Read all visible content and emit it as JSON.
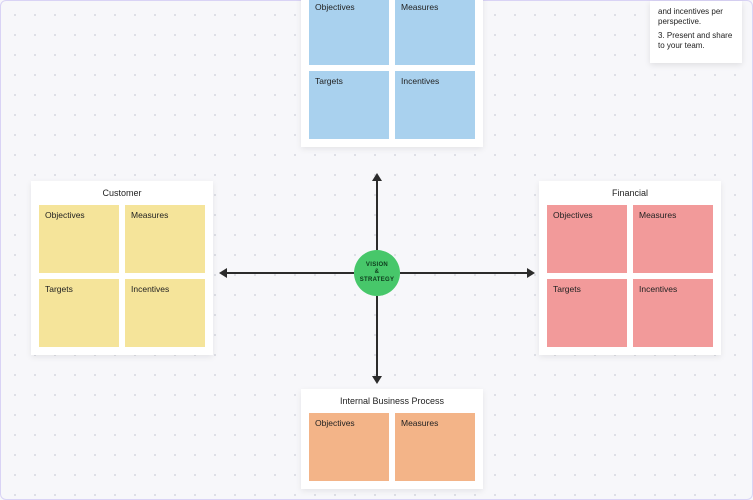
{
  "center": {
    "line1": "VISION",
    "line2": "&",
    "line3": "STRATEGY"
  },
  "quadrants": {
    "top": {
      "title": "",
      "cells": [
        "Objectives",
        "Measures",
        "Targets",
        "Incentives"
      ]
    },
    "left": {
      "title": "Customer",
      "cells": [
        "Objectives",
        "Measures",
        "Targets",
        "Incentives"
      ]
    },
    "right": {
      "title": "Financial",
      "cells": [
        "Objectives",
        "Measures",
        "Targets",
        "Incentives"
      ]
    },
    "bottom": {
      "title": "Internal Business Process",
      "cells": [
        "Objectives",
        "Measures"
      ]
    }
  },
  "note": {
    "line1": "and incentives per perspective.",
    "line2": "3. Present and share to your team."
  },
  "colors": {
    "yellow": "#f5e49a",
    "blue": "#a9d1ee",
    "pink": "#f29a9a",
    "orange": "#f3b488",
    "green": "#47c76a"
  }
}
